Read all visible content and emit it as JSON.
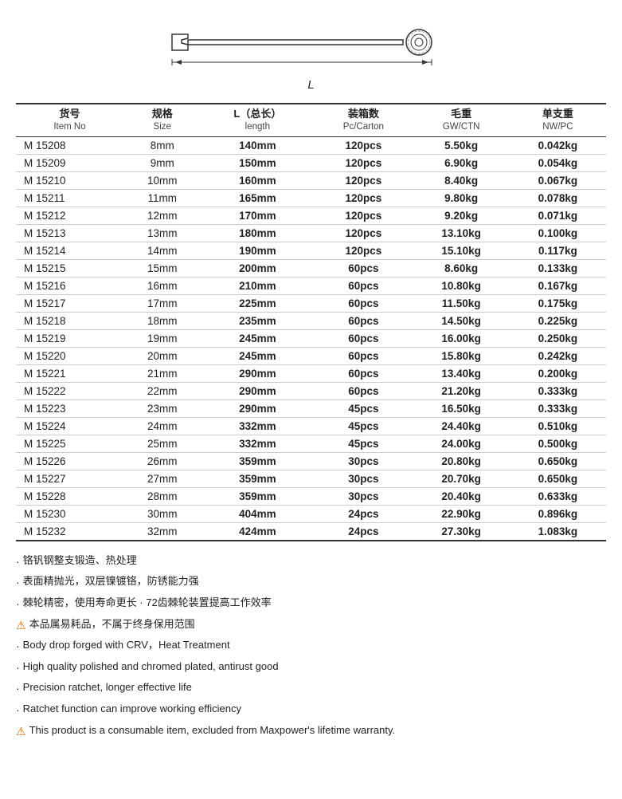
{
  "diagram": {
    "length_label": "L"
  },
  "table": {
    "headers": [
      {
        "zh": "货号",
        "en": "Item No"
      },
      {
        "zh": "规格",
        "en": "Size"
      },
      {
        "zh": "L（总长）",
        "en": "length"
      },
      {
        "zh": "装箱数",
        "en": "Pc/Carton"
      },
      {
        "zh": "毛重",
        "en": "GW/CTN"
      },
      {
        "zh": "单支重",
        "en": "NW/PC"
      }
    ],
    "rows": [
      [
        "M 15208",
        "8mm",
        "140mm",
        "120pcs",
        "5.50kg",
        "0.042kg"
      ],
      [
        "M 15209",
        "9mm",
        "150mm",
        "120pcs",
        "6.90kg",
        "0.054kg"
      ],
      [
        "M 15210",
        "10mm",
        "160mm",
        "120pcs",
        "8.40kg",
        "0.067kg"
      ],
      [
        "M 15211",
        "11mm",
        "165mm",
        "120pcs",
        "9.80kg",
        "0.078kg"
      ],
      [
        "M 15212",
        "12mm",
        "170mm",
        "120pcs",
        "9.20kg",
        "0.071kg"
      ],
      [
        "M 15213",
        "13mm",
        "180mm",
        "120pcs",
        "13.10kg",
        "0.100kg"
      ],
      [
        "M 15214",
        "14mm",
        "190mm",
        "120pcs",
        "15.10kg",
        "0.117kg"
      ],
      [
        "M 15215",
        "15mm",
        "200mm",
        "60pcs",
        "8.60kg",
        "0.133kg"
      ],
      [
        "M 15216",
        "16mm",
        "210mm",
        "60pcs",
        "10.80kg",
        "0.167kg"
      ],
      [
        "M 15217",
        "17mm",
        "225mm",
        "60pcs",
        "11.50kg",
        "0.175kg"
      ],
      [
        "M 15218",
        "18mm",
        "235mm",
        "60pcs",
        "14.50kg",
        "0.225kg"
      ],
      [
        "M 15219",
        "19mm",
        "245mm",
        "60pcs",
        "16.00kg",
        "0.250kg"
      ],
      [
        "M 15220",
        "20mm",
        "245mm",
        "60pcs",
        "15.80kg",
        "0.242kg"
      ],
      [
        "M 15221",
        "21mm",
        "290mm",
        "60pcs",
        "13.40kg",
        "0.200kg"
      ],
      [
        "M 15222",
        "22mm",
        "290mm",
        "60pcs",
        "21.20kg",
        "0.333kg"
      ],
      [
        "M 15223",
        "23mm",
        "290mm",
        "45pcs",
        "16.50kg",
        "0.333kg"
      ],
      [
        "M 15224",
        "24mm",
        "332mm",
        "45pcs",
        "24.40kg",
        "0.510kg"
      ],
      [
        "M 15225",
        "25mm",
        "332mm",
        "45pcs",
        "24.00kg",
        "0.500kg"
      ],
      [
        "M 15226",
        "26mm",
        "359mm",
        "30pcs",
        "20.80kg",
        "0.650kg"
      ],
      [
        "M 15227",
        "27mm",
        "359mm",
        "30pcs",
        "20.70kg",
        "0.650kg"
      ],
      [
        "M 15228",
        "28mm",
        "359mm",
        "30pcs",
        "20.40kg",
        "0.633kg"
      ],
      [
        "M 15230",
        "30mm",
        "404mm",
        "24pcs",
        "22.90kg",
        "0.896kg"
      ],
      [
        "M 15232",
        "32mm",
        "424mm",
        "24pcs",
        "27.30kg",
        "1.083kg"
      ]
    ]
  },
  "notes": [
    {
      "type": "dot",
      "text": "铬钒钢整支锻造、热处理"
    },
    {
      "type": "dot",
      "text": "表面精抛光，双层镍镀铬，防锈能力强"
    },
    {
      "type": "dot",
      "text": "棘轮精密，使用寿命更长    · 72齿棘轮装置提高工作效率"
    },
    {
      "type": "warning",
      "text": "本品属易耗品，不属于终身保用范围"
    },
    {
      "type": "dot",
      "text": "Body drop forged with CRV，Heat Treatment"
    },
    {
      "type": "dot",
      "text": "High quality polished and chromed plated, antirust good"
    },
    {
      "type": "dot",
      "text": "Precision ratchet, longer effective life"
    },
    {
      "type": "dot",
      "text": "Ratchet function can improve working efficiency"
    },
    {
      "type": "warning",
      "text": "This product is a consumable item, excluded from Maxpower's lifetime warranty."
    }
  ]
}
